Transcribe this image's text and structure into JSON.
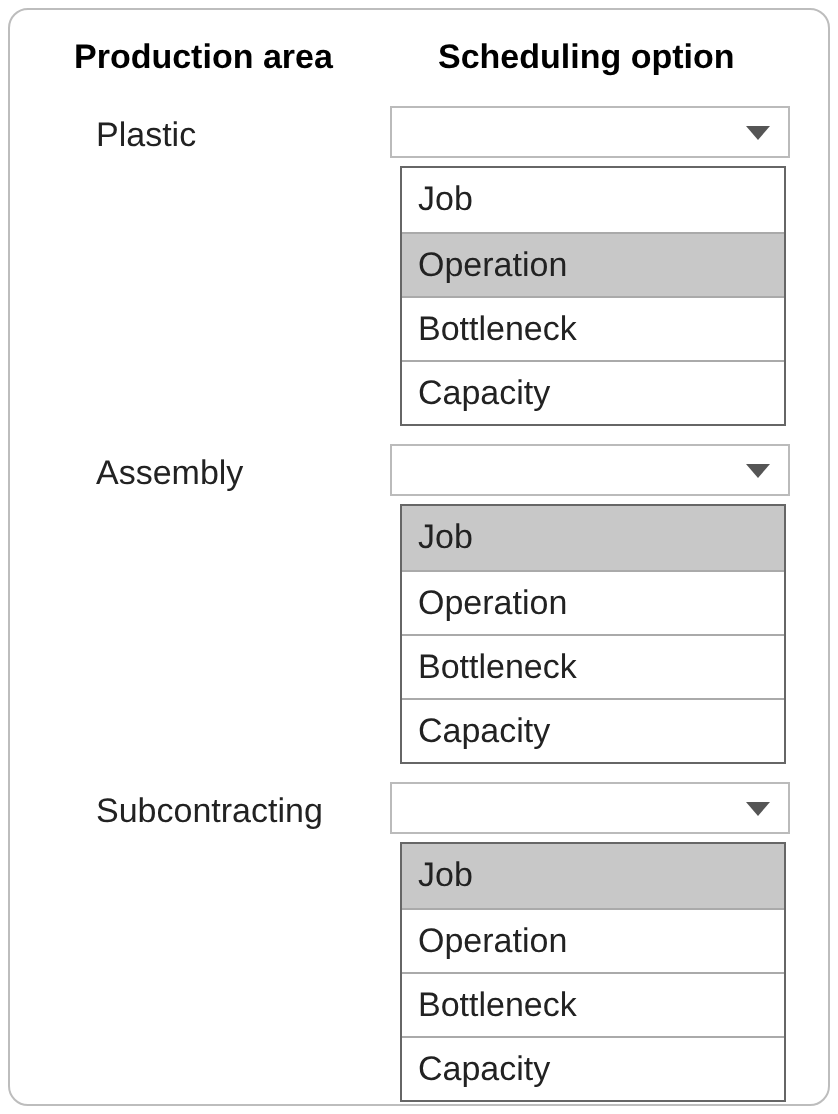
{
  "columns": [
    "Production area",
    "Scheduling option"
  ],
  "rows": [
    {
      "area": "Plastic",
      "options": [
        {
          "label": "Job",
          "selected": false
        },
        {
          "label": "Operation",
          "selected": true
        },
        {
          "label": "Bottleneck",
          "selected": false
        },
        {
          "label": "Capacity",
          "selected": false
        }
      ]
    },
    {
      "area": "Assembly",
      "options": [
        {
          "label": "Job",
          "selected": true
        },
        {
          "label": "Operation",
          "selected": false
        },
        {
          "label": "Bottleneck",
          "selected": false
        },
        {
          "label": "Capacity",
          "selected": false
        }
      ]
    },
    {
      "area": "Subcontracting",
      "options": [
        {
          "label": "Job",
          "selected": true
        },
        {
          "label": "Operation",
          "selected": false
        },
        {
          "label": "Bottleneck",
          "selected": false
        },
        {
          "label": "Capacity",
          "selected": false
        }
      ]
    }
  ]
}
